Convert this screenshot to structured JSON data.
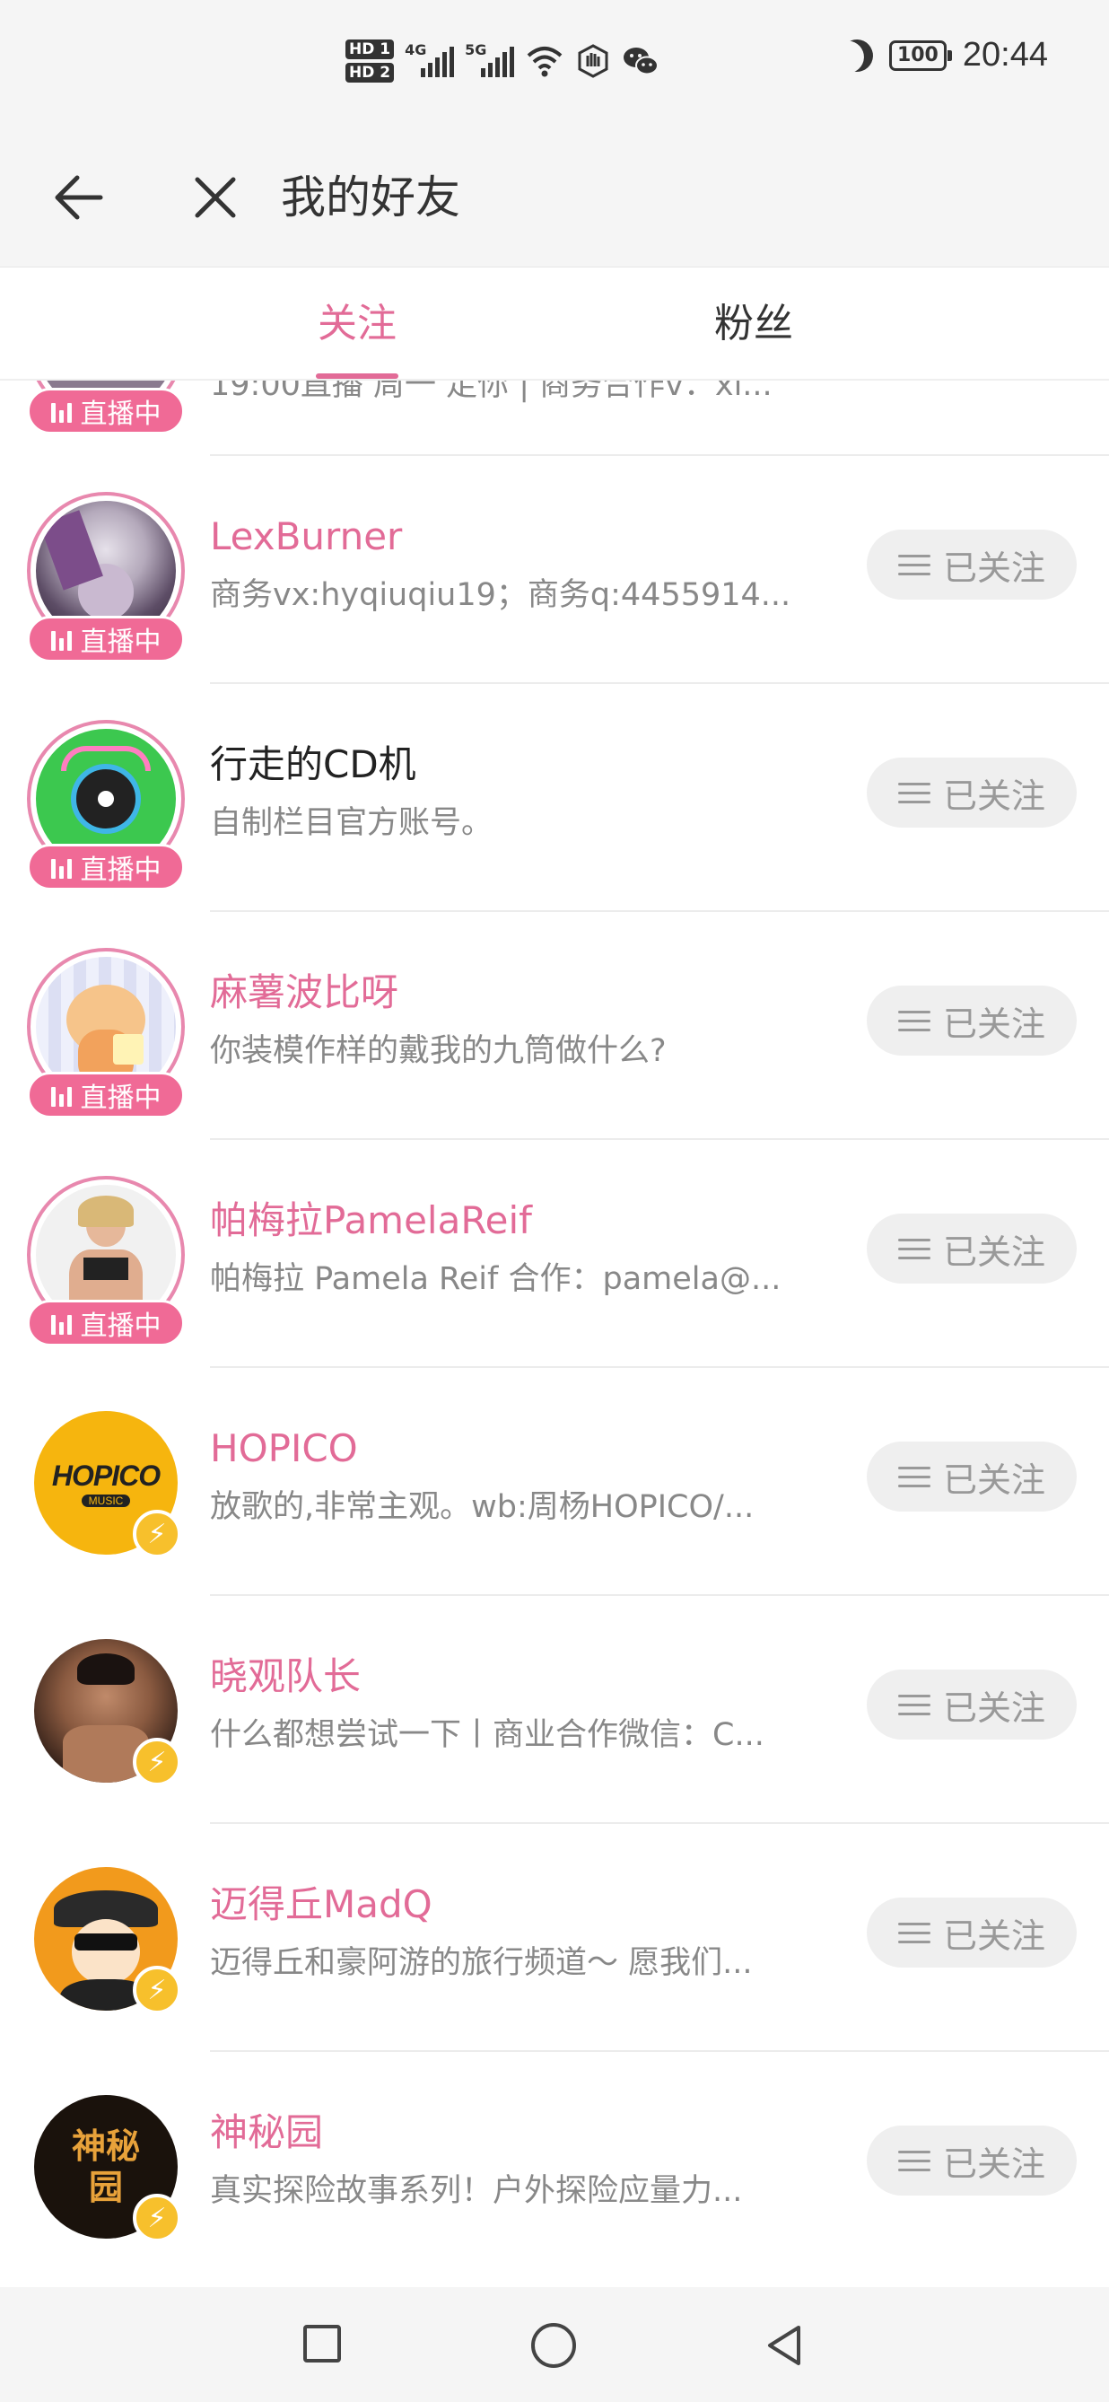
{
  "status_bar": {
    "hd1": "HD 1",
    "hd2": "HD 2",
    "gen1": "4G",
    "gen2": "5G",
    "battery": "100",
    "time": "20:44"
  },
  "header": {
    "title": "我的好友"
  },
  "tabs": [
    {
      "label": "关注",
      "active": true
    },
    {
      "label": "粉丝",
      "active": false
    }
  ],
  "partial_item": {
    "desc": "19:00直播 周一 走你 | 商务合作v：xi...",
    "live_label": "直播中"
  },
  "follow_button_label": "已关注",
  "live_label": "直播中",
  "friends": [
    {
      "name": "LexBurner",
      "desc": "商务vx:hyqiuqiu19；商务q:4455914...",
      "live": true,
      "name_color": "pink"
    },
    {
      "name": "行走的CD机",
      "desc": "自制栏目官方账号。",
      "live": true,
      "name_color": "dark"
    },
    {
      "name": "麻薯波比呀",
      "desc": "你装模作样的戴我的九筒做什么?",
      "live": true,
      "name_color": "pink"
    },
    {
      "name": "帕梅拉PamelaReif",
      "desc": "帕梅拉 Pamela Reif 合作：pamela@...",
      "live": true,
      "name_color": "pink"
    },
    {
      "name": "HOPICO",
      "desc": "放歌的,非常主观。wb:周杨HOPICO/...",
      "live": false,
      "name_color": "pink",
      "avatar_text": "HOPICO",
      "avatar_sub": "MUSIC"
    },
    {
      "name": "晓观队长",
      "desc": "什么都想尝试一下丨商业合作微信：C...",
      "live": false,
      "name_color": "pink"
    },
    {
      "name": "迈得丘MadQ",
      "desc": "迈得丘和豪阿游的旅行频道～ 愿我们...",
      "live": false,
      "name_color": "pink"
    },
    {
      "name": "神秘园",
      "desc": "真实探险故事系列！户外探险应量力...",
      "live": false,
      "name_color": "pink",
      "avatar_text": "神秘园"
    }
  ]
}
